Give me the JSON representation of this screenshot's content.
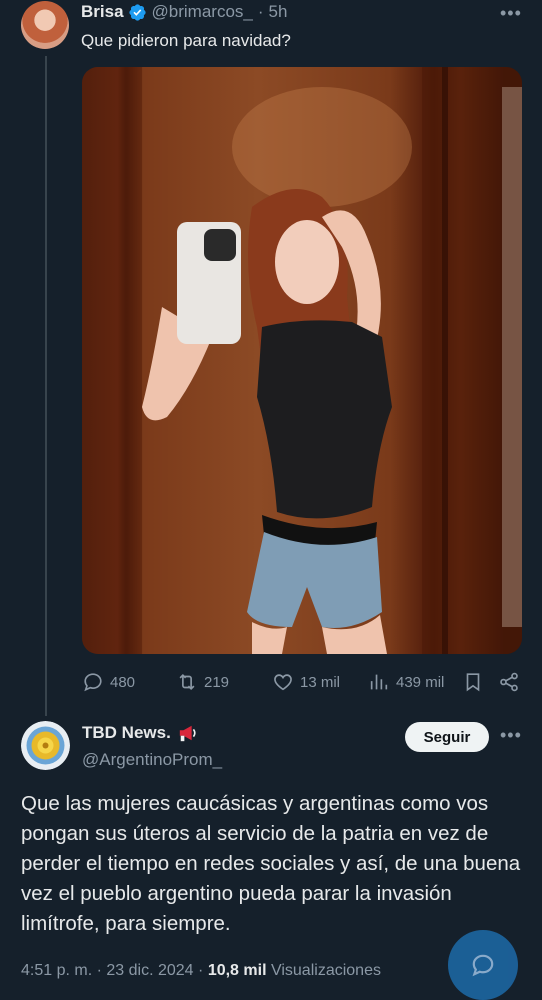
{
  "tweet1": {
    "author_name": "Brisa",
    "author_handle": "@brimarcos_",
    "time": "5h",
    "separator": "·",
    "text": "Que pidieron para navidad?",
    "stats": {
      "replies": "480",
      "reposts": "219",
      "likes": "13 mil",
      "views": "439 mil"
    }
  },
  "tweet2": {
    "author_name": "TBD News.",
    "author_handle": "@ArgentinoProm_",
    "follow_label": "Seguir",
    "text": "Que las mujeres caucásicas y argentinas como vos pongan sus úteros al servicio de la patria en vez de perder el tiempo en redes sociales y así, de una buena vez el pueblo argentino pueda parar la invasión limítrofe, para siempre.",
    "time": "4:51 p. m.",
    "date": "23 dic. 2024",
    "views_count": "10,8 mil",
    "views_label": "Visualizaciones",
    "separator": "·"
  },
  "colors": {
    "background": "#15202b",
    "text": "#e7e9ea",
    "muted": "#8b98a5",
    "verified": "#1d9bf0",
    "fab": "#1d6aa8"
  },
  "icons": [
    "more-icon",
    "verified-badge-icon",
    "reply-icon",
    "repost-icon",
    "like-icon",
    "views-icon",
    "bookmark-icon",
    "share-icon",
    "megaphone-icon",
    "chat-fab-icon"
  ]
}
